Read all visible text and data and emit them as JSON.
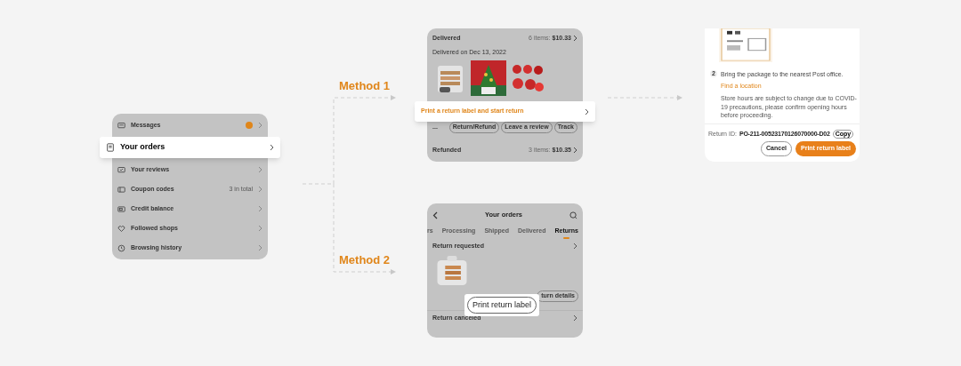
{
  "account_menu": {
    "items": [
      {
        "label": "Messages",
        "highlighted": false,
        "badge": true
      },
      {
        "label": "Your orders",
        "highlighted": true,
        "badge": false
      },
      {
        "label": "Your reviews",
        "highlighted": false,
        "badge": false
      },
      {
        "label": "Coupon codes",
        "highlighted": false,
        "badge": false,
        "value": "3 in total"
      },
      {
        "label": "Credit balance",
        "highlighted": false,
        "badge": false
      },
      {
        "label": "Followed shops",
        "highlighted": false,
        "badge": false
      },
      {
        "label": "Browsing history",
        "highlighted": false,
        "badge": false
      }
    ]
  },
  "methods": [
    {
      "label": "Method 1"
    },
    {
      "label": "Method 2"
    }
  ],
  "order_card": {
    "status": "Delivered",
    "count": "6 items:",
    "total": "$10.33",
    "date": "Delivered on Dec 13, 2022",
    "callout": "Print a return label and start return",
    "more": "...",
    "actions": [
      "Return/Refund",
      "Leave a review",
      "Track"
    ],
    "footer_status": "Refunded",
    "footer_count": "3 items:",
    "footer_total": "$10.35"
  },
  "return_sheet": {
    "step_number": "2",
    "step_text": "Bring the package to the nearest Post office.",
    "link": "Find a location",
    "note": "Store hours are subject to change due to COVID-19 precautions, please confirm opening hours before proceeding.",
    "id_label": "Return ID:",
    "return_id": "PO-211-00523170126070000-D02",
    "copy": "Copy",
    "buttons": [
      {
        "label": "Cancel",
        "kind": "secondary"
      },
      {
        "label": "Print return label",
        "kind": "primary"
      }
    ]
  },
  "returns_screen": {
    "title": "Your orders",
    "tabs": [
      {
        "label": "rs",
        "selected": false
      },
      {
        "label": "Processing",
        "selected": false
      },
      {
        "label": "Shipped",
        "selected": false
      },
      {
        "label": "Delivered",
        "selected": false
      },
      {
        "label": "Returns",
        "selected": true
      }
    ],
    "section": "Return requested",
    "callout": "Print return label",
    "details_button": "turn details",
    "footer": "Return canceled"
  }
}
